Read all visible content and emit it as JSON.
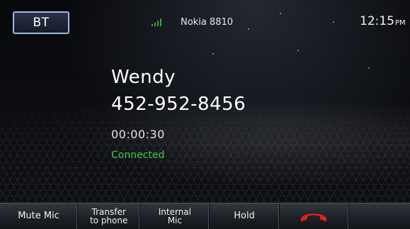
{
  "status_bar": {
    "bt_label": "BT",
    "device_name": "Nokia 8810",
    "time": "12:15",
    "time_suffix": "PM"
  },
  "call": {
    "caller_name": "Wendy",
    "phone_number": "452-952-8456",
    "duration": "00:00:30",
    "status": "Connected"
  },
  "bottom_bar": {
    "mute_mic": "Mute Mic",
    "transfer_line1": "Transfer",
    "transfer_line2": "to phone",
    "internal_line1": "Internal",
    "internal_line2": "Mic",
    "hold": "Hold",
    "end_call_icon": "phone-hangup-icon"
  },
  "colors": {
    "status_green": "#3fc84f",
    "signal_green": "#2aa84a",
    "end_call_red": "#e02020",
    "bt_border": "#9fb8e6"
  }
}
